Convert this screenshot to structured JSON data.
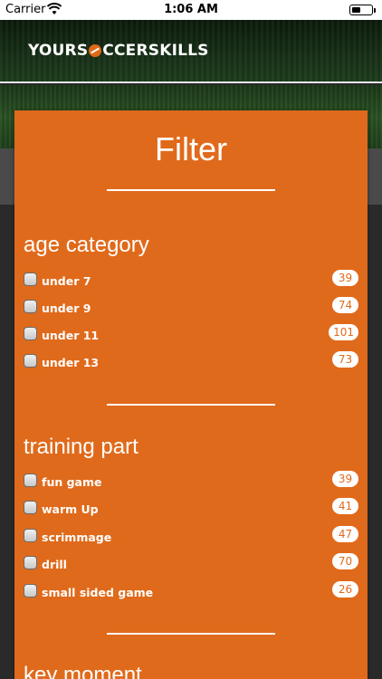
{
  "status_bar": {
    "carrier": "Carrier",
    "time": "1:06 AM"
  },
  "header": {
    "logo_left": "YOURS",
    "logo_right": "CCERSKILLS"
  },
  "filter": {
    "title": "Filter",
    "sections": [
      {
        "title": "age category",
        "items": [
          {
            "label": "under 7",
            "count": "39"
          },
          {
            "label": "under 9",
            "count": "74"
          },
          {
            "label": "under 11",
            "count": "101"
          },
          {
            "label": "under 13",
            "count": "73"
          }
        ]
      },
      {
        "title": "training part",
        "items": [
          {
            "label": "fun game",
            "count": "39"
          },
          {
            "label": "warm Up",
            "count": "41"
          },
          {
            "label": "scrimmage",
            "count": "47"
          },
          {
            "label": "drill",
            "count": "70"
          },
          {
            "label": "small sided game",
            "count": "26"
          }
        ]
      },
      {
        "title": "key moment",
        "items": []
      }
    ]
  },
  "colors": {
    "accent": "#e06a1b",
    "count_text": "#e06a1b"
  }
}
